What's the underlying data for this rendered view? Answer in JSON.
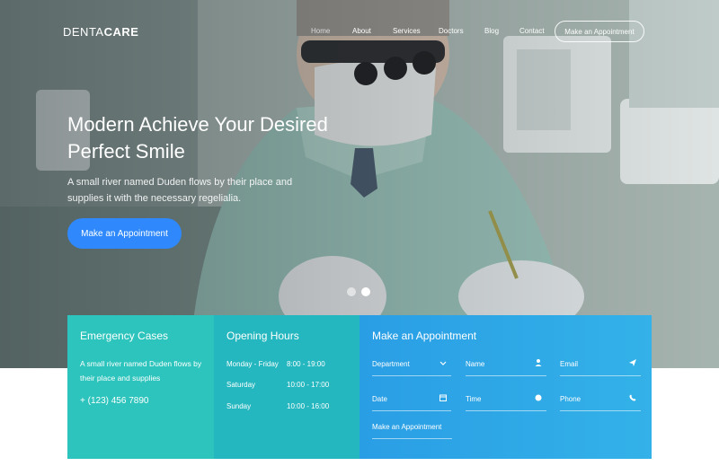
{
  "brand": {
    "prefix": "DENTA",
    "suffix": "CARE"
  },
  "nav": {
    "items": [
      {
        "label": "Home",
        "active": true
      },
      {
        "label": "About"
      },
      {
        "label": "Services"
      },
      {
        "label": "Doctors"
      },
      {
        "label": "Blog"
      },
      {
        "label": "Contact"
      }
    ],
    "cta": "Make an Appointment"
  },
  "hero": {
    "title": "Modern Achieve Your Desired Perfect Smile",
    "text": "A small river named Duden flows by their place and supplies it with the necessary regelialia.",
    "button": "Make an Appointment",
    "slide_count": 2,
    "active_slide": 2
  },
  "emergency": {
    "title": "Emergency Cases",
    "text": "A small river named Duden flows by their place and supplies",
    "phone": "+ (123) 456 7890"
  },
  "hours": {
    "title": "Opening Hours",
    "rows": [
      {
        "day": "Monday - Friday",
        "time": "8:00 - 19:00"
      },
      {
        "day": "Saturday",
        "time": "10:00 - 17:00"
      },
      {
        "day": "Sunday",
        "time": "10:00 - 16:00"
      }
    ]
  },
  "appointment": {
    "title": "Make an Appointment",
    "fields": {
      "department": "Department",
      "name": "Name",
      "email": "Email",
      "date": "Date",
      "time": "Time",
      "phone": "Phone"
    },
    "submit": "Make an Appointment"
  },
  "colors": {
    "accent_blue": "#2f89fc",
    "teal": "#2cc4bc",
    "teal_dark": "#25b7bf",
    "appointment_blue": "#2a9ee5"
  }
}
